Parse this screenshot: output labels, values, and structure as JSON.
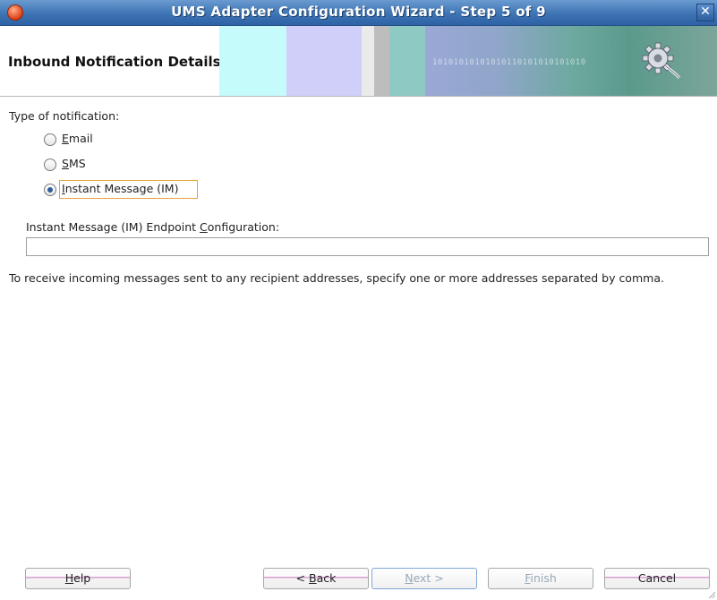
{
  "window": {
    "title": "UMS Adapter Configuration Wizard - Step 5 of 9"
  },
  "header": {
    "heading": "Inbound Notification Details",
    "banner_bits": "10101010101010110101010101010"
  },
  "form": {
    "type_label": "Type of notification:",
    "options": [
      {
        "label": "Email",
        "mnemonic": "E",
        "rest": "mail",
        "selected": false
      },
      {
        "label": "SMS",
        "mnemonic": "S",
        "rest": "MS",
        "selected": false
      },
      {
        "label": "Instant Message (IM)",
        "mnemonic": "I",
        "rest": "nstant Message (IM)",
        "selected": true
      }
    ],
    "endpoint_label_pre": "Instant Message (IM) Endpoint ",
    "endpoint_label_mn": "C",
    "endpoint_label_post": "onfiguration:",
    "endpoint_value": "",
    "help_text": "To receive incoming messages sent to any recipient addresses, specify one or more addresses separated by comma."
  },
  "buttons": {
    "help": {
      "mn": "H",
      "rest": "elp"
    },
    "back": {
      "pre": "< ",
      "mn": "B",
      "rest": "ack"
    },
    "next": {
      "mn": "N",
      "rest": "ext >"
    },
    "finish": {
      "mn": "F",
      "rest": "inish"
    },
    "cancel": {
      "label": "Cancel"
    }
  },
  "colors": {
    "title_bar": "#3e74b4",
    "radio_dot": "#2f5f9a",
    "focus": "#e8a33c",
    "button_stripe": "#d99fd2"
  }
}
